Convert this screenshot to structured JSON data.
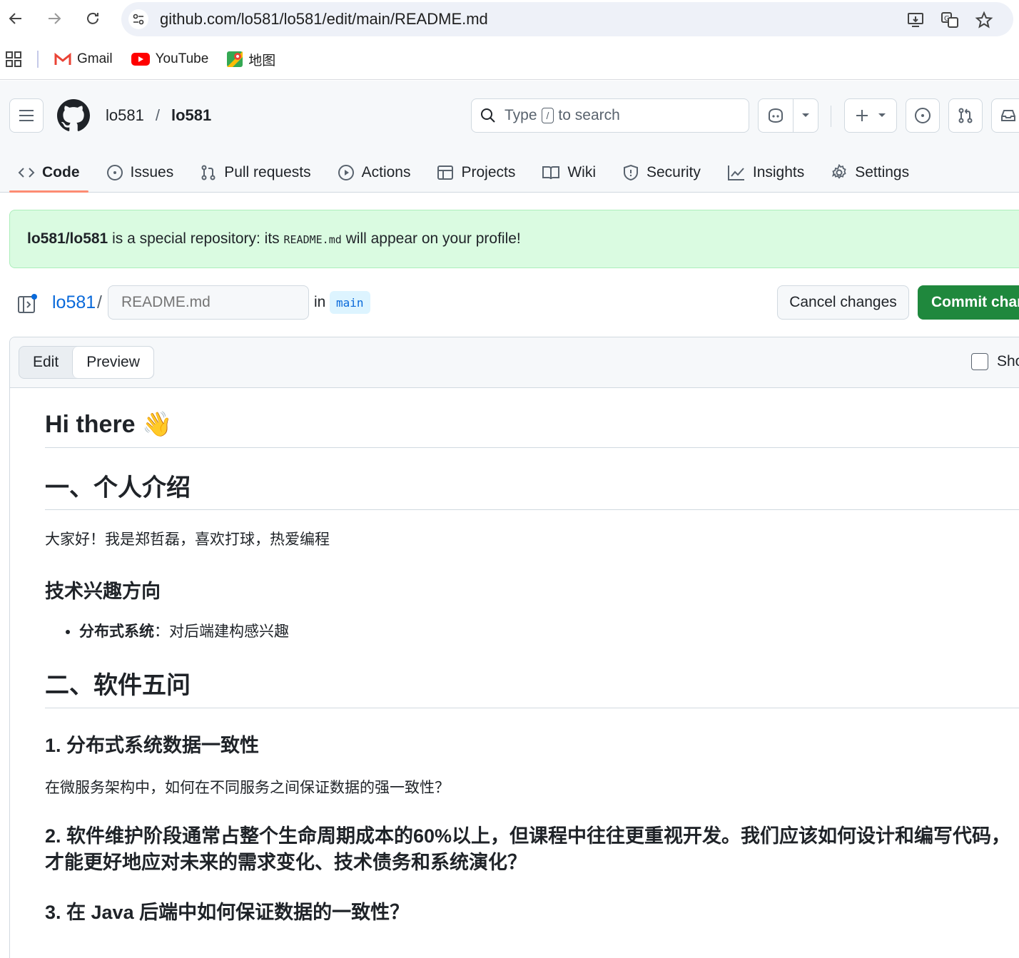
{
  "browser": {
    "url": "github.com/lo581/lo581/edit/main/README.md",
    "bookmarks": [
      "Gmail",
      "YouTube",
      "地图"
    ]
  },
  "header": {
    "owner": "lo581",
    "separator": "/",
    "repo": "lo581",
    "search_prefix": "Type",
    "search_key": "/",
    "search_suffix": "to search"
  },
  "tabs": [
    {
      "label": "Code",
      "icon": "code-icon"
    },
    {
      "label": "Issues",
      "icon": "issue-icon"
    },
    {
      "label": "Pull requests",
      "icon": "pull-request-icon"
    },
    {
      "label": "Actions",
      "icon": "play-icon"
    },
    {
      "label": "Projects",
      "icon": "table-icon"
    },
    {
      "label": "Wiki",
      "icon": "book-icon"
    },
    {
      "label": "Security",
      "icon": "shield-icon"
    },
    {
      "label": "Insights",
      "icon": "graph-icon"
    },
    {
      "label": "Settings",
      "icon": "gear-icon"
    }
  ],
  "flash": {
    "repo": "lo581/lo581",
    "text1": " is a special repository: its ",
    "file": "README.md",
    "text2": " will appear on your profile!"
  },
  "editbar": {
    "owner": "lo581",
    "slash": "/",
    "filename_placeholder": "README.md",
    "in": "in",
    "branch": "main",
    "cancel": "Cancel changes",
    "commit": "Commit changes..."
  },
  "panel": {
    "edit": "Edit",
    "preview": "Preview",
    "show_diff": "Show diff"
  },
  "preview": {
    "h1": "Hi there 👋",
    "h2a": "一、个人介绍",
    "p1": "大家好！我是郑哲磊，喜欢打球，热爱编程",
    "h3a": "技术兴趣方向",
    "li_bold": "分布式系统",
    "li_text": "：对后端建构感兴趣",
    "h2b": "二、软件五问",
    "q1": "1. 分布式系统数据一致性",
    "p2": "在微服务架构中，如何在不同服务之间保证数据的强一致性？",
    "q2": "2. 软件维护阶段通常占整个生命周期成本的60%以上，但课程中往往更重视开发。我们应该如何设计和编写代码，才能更好地应对未来的需求变化、技术债务和系统演化？",
    "q3": "3. 在 Java 后端中如何保证数据的一致性？"
  }
}
